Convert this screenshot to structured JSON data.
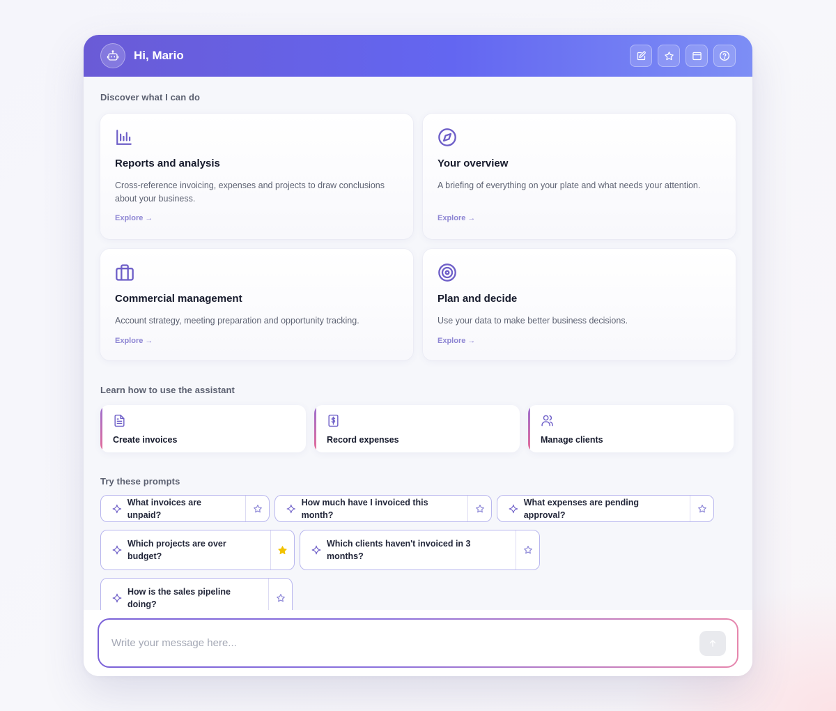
{
  "header": {
    "greeting": "Hi, Mario",
    "actions": [
      {
        "icon": "edit-icon"
      },
      {
        "icon": "star-icon"
      },
      {
        "icon": "window-icon"
      },
      {
        "icon": "help-icon"
      }
    ]
  },
  "discover": {
    "title": "Discover what I can do",
    "cards": [
      {
        "icon": "bar-chart-icon",
        "title": "Reports and analysis",
        "description": "Cross-reference invoicing, expenses and projects to draw conclusions about your business.",
        "link": "Explore →"
      },
      {
        "icon": "compass-icon",
        "title": "Your overview",
        "description": "A briefing of everything on your plate and what needs your attention.",
        "link": "Explore →"
      },
      {
        "icon": "briefcase-icon",
        "title": "Commercial management",
        "description": "Account strategy, meeting preparation and opportunity tracking.",
        "link": "Explore →"
      },
      {
        "icon": "target-icon",
        "title": "Plan and decide",
        "description": "Use your data to make better business decisions.",
        "link": "Explore →"
      }
    ]
  },
  "learn": {
    "title": "Learn how to use the assistant",
    "items": [
      {
        "icon": "document-icon",
        "label": "Create invoices"
      },
      {
        "icon": "receipt-dollar-icon",
        "label": "Record expenses"
      },
      {
        "icon": "users-icon",
        "label": "Manage clients"
      }
    ]
  },
  "prompts": {
    "title": "Try these prompts",
    "items": [
      {
        "text": "What invoices are unpaid?",
        "favorite": false
      },
      {
        "text": "How much have I invoiced this month?",
        "favorite": false
      },
      {
        "text": "What expenses are pending approval?",
        "favorite": false
      },
      {
        "text": "Which projects are over budget?",
        "favorite": true
      },
      {
        "text": "Which clients haven't invoiced in 3 months?",
        "favorite": false
      },
      {
        "text": "How is the sales pipeline doing?",
        "favorite": false
      }
    ]
  },
  "composer": {
    "placeholder": "Write your message here..."
  },
  "colors": {
    "accent": "#6366f1",
    "icon": "#6e5fc8",
    "favorite": "#f2c200"
  }
}
